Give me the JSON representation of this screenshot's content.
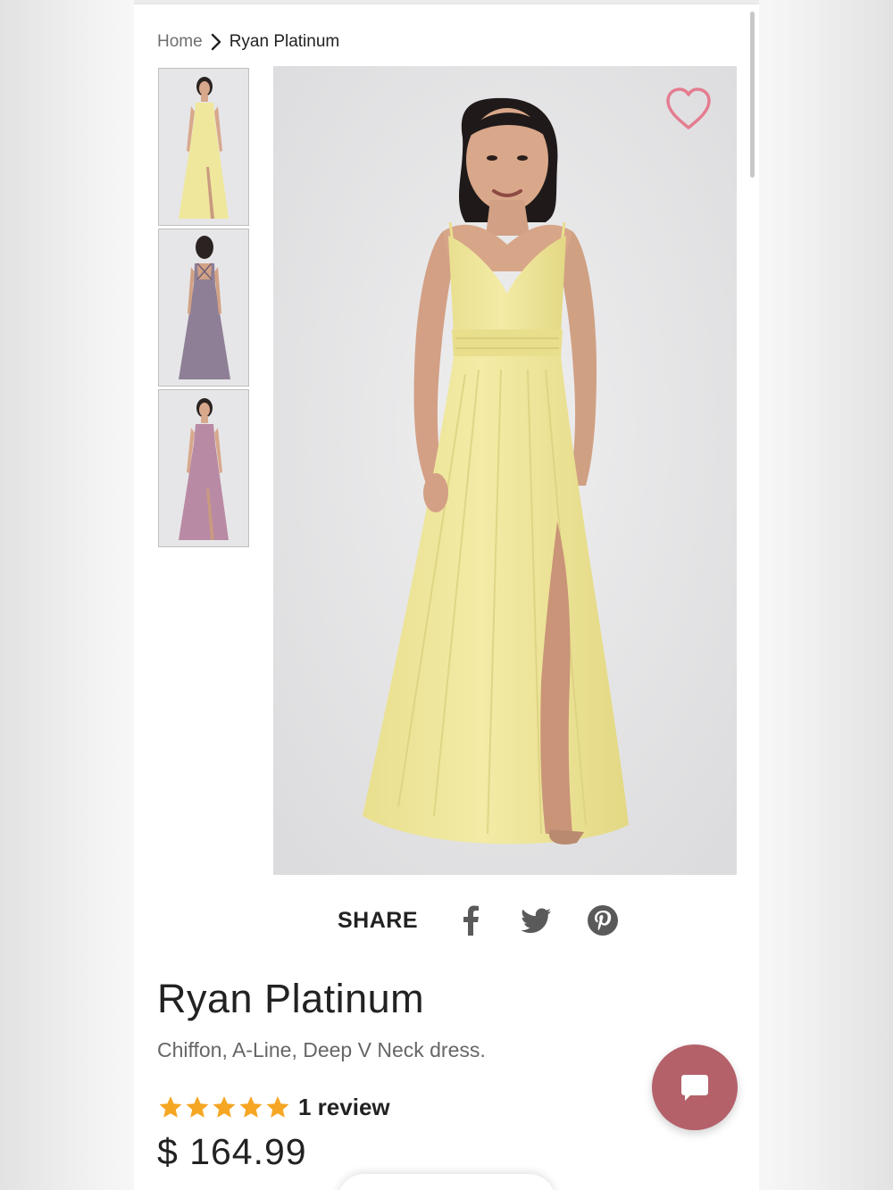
{
  "breadcrumb": {
    "home": "Home",
    "current": "Ryan Platinum"
  },
  "gallery": {
    "thumbnails": [
      {
        "name": "yellow-front",
        "color": "#efe79c"
      },
      {
        "name": "lavender-back",
        "color": "#8e7f96"
      },
      {
        "name": "mauve-front",
        "color": "#b98aa4"
      }
    ],
    "main_dress_color": "#f1e9a2",
    "favorite_icon": "heart-outline-icon",
    "favorite_color": "#e47d90"
  },
  "share": {
    "label": "SHARE",
    "icons": [
      "facebook-icon",
      "twitter-icon",
      "pinterest-icon"
    ]
  },
  "product": {
    "title": "Ryan Platinum",
    "description": "Chiffon, A-Line, Deep V Neck dress.",
    "rating_stars": 5,
    "review_text": "1 review",
    "price": "$ 164.99",
    "star_color": "#f5a623"
  },
  "chat": {
    "icon": "chat-bubble-icon",
    "color": "#b4616a"
  }
}
